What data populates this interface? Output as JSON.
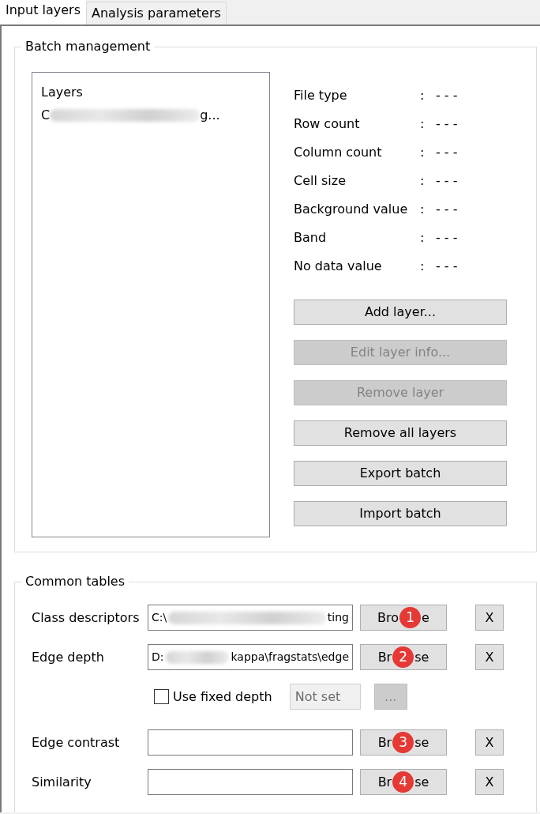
{
  "tabs": [
    {
      "label": "Input layers",
      "selected": true
    },
    {
      "label": "Analysis parameters",
      "selected": false
    }
  ],
  "batch_management": {
    "title": "Batch management",
    "layers_list": {
      "header": "Layers",
      "items": [
        {
          "text_start": "C",
          "text_end": "g...",
          "blurred": true
        }
      ]
    },
    "info": [
      {
        "label": "File type",
        "separator": ":",
        "value": "- - -"
      },
      {
        "label": "Row count",
        "separator": ":",
        "value": "- - -"
      },
      {
        "label": "Column count",
        "separator": ":",
        "value": "- - -"
      },
      {
        "label": "Cell size",
        "separator": ":",
        "value": "- - -"
      },
      {
        "label": "Background value",
        "separator": ":",
        "value": "- - -"
      },
      {
        "label": "Band",
        "separator": ":",
        "value": "- - -"
      },
      {
        "label": "No data value",
        "separator": ":",
        "value": "- - -"
      }
    ],
    "buttons": [
      {
        "label": "Add layer...",
        "disabled": false
      },
      {
        "label": "Edit layer info...",
        "disabled": true
      },
      {
        "label": "Remove layer",
        "disabled": true
      },
      {
        "label": "Remove all layers",
        "disabled": false
      },
      {
        "label": "Export batch",
        "disabled": false
      },
      {
        "label": "Import batch",
        "disabled": false
      }
    ]
  },
  "common_tables": {
    "title": "Common tables",
    "rows": [
      {
        "kind": "table",
        "label": "Class descriptors",
        "value_start": "C:\\",
        "value_end": "ting",
        "blurred": true,
        "browse": {
          "before": "Bro",
          "after": "e",
          "badge": "1"
        },
        "clear": "X"
      },
      {
        "kind": "table",
        "label": "Edge depth",
        "value_start": "D:",
        "value_end": "kappa\\fragstats\\edge",
        "blurred": true,
        "browse": {
          "before": "Br",
          "after": "se",
          "badge": "2"
        },
        "clear": "X"
      },
      {
        "kind": "option",
        "label": "Use fixed depth",
        "checked": false,
        "field": "Not set",
        "button": "..."
      },
      {
        "kind": "table",
        "label": "Edge contrast",
        "blurred": false,
        "browse": {
          "before": "Br",
          "after": "se",
          "badge": "3"
        },
        "clear": "X"
      },
      {
        "kind": "table",
        "label": "Similarity",
        "blurred": false,
        "browse": {
          "before": "Br",
          "after": "se",
          "badge": "4"
        },
        "clear": "X"
      }
    ]
  }
}
